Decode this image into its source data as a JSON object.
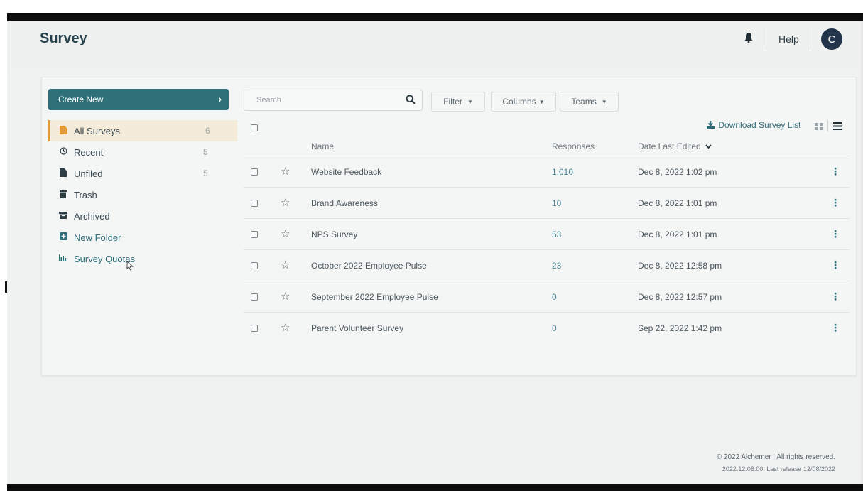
{
  "header": {
    "title": "Survey",
    "help_label": "Help",
    "avatar_initial": "C"
  },
  "sidebar": {
    "create_label": "Create New",
    "items": [
      {
        "label": "All Surveys",
        "count": "6",
        "icon": "folder-icon"
      },
      {
        "label": "Recent",
        "count": "5",
        "icon": "clock-icon"
      },
      {
        "label": "Unfiled",
        "count": "5",
        "icon": "file-icon"
      },
      {
        "label": "Trash",
        "count": "",
        "icon": "trash-icon"
      },
      {
        "label": "Archived",
        "count": "",
        "icon": "archive-icon"
      },
      {
        "label": "New Folder",
        "count": "",
        "icon": "plus-square-icon"
      },
      {
        "label": "Survey Quotas",
        "count": "",
        "icon": "bar-chart-icon"
      }
    ]
  },
  "toolbar": {
    "search_placeholder": "Search",
    "filter_label": "Filter",
    "columns_label": "Columns",
    "teams_label": "Teams",
    "download_label": "Download Survey List"
  },
  "table": {
    "headers": {
      "name": "Name",
      "responses": "Responses",
      "date": "Date Last Edited"
    },
    "rows": [
      {
        "name": "Website Feedback",
        "responses": "1,010",
        "date": "Dec 8, 2022 1:02 pm"
      },
      {
        "name": "Brand Awareness",
        "responses": "10",
        "date": "Dec 8, 2022 1:01 pm"
      },
      {
        "name": "NPS Survey",
        "responses": "53",
        "date": "Dec 8, 2022 1:01 pm"
      },
      {
        "name": "October 2022 Employee Pulse",
        "responses": "23",
        "date": "Dec 8, 2022 12:58 pm"
      },
      {
        "name": "September 2022 Employee Pulse",
        "responses": "0",
        "date": "Dec 8, 2022 12:57 pm"
      },
      {
        "name": "Parent Volunteer Survey",
        "responses": "0",
        "date": "Sep 22, 2022 1:42 pm"
      }
    ]
  },
  "footer": {
    "copyright": "© 2022 Alchemer | All rights reserved.",
    "release": "2022.12.08.00. Last release 12/08/2022"
  },
  "colors": {
    "accent": "#2e6f78",
    "active_item": "#f5ebd9",
    "active_border": "#e09a3a",
    "avatar": "#22354a"
  }
}
